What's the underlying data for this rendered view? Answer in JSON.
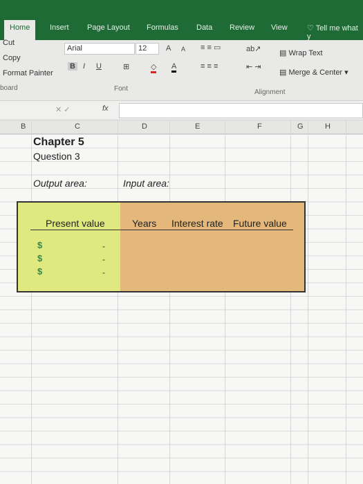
{
  "ribbon": {
    "tabs": [
      {
        "label": "Home"
      },
      {
        "label": "Insert"
      },
      {
        "label": "Page Layout"
      },
      {
        "label": "Formulas"
      },
      {
        "label": "Data"
      },
      {
        "label": "Review"
      },
      {
        "label": "View"
      }
    ],
    "tell_me": "Tell me what y",
    "clipboard": {
      "cut": "Cut",
      "copy": "Copy",
      "format_painter": "Format Painter",
      "group": "board"
    },
    "font": {
      "name": "Arial",
      "size": "12",
      "bold": "B",
      "italic": "I",
      "underline": "U",
      "group": "Font"
    },
    "alignment": {
      "wrap_text": "Wrap Text",
      "merge_center": "Merge & Center",
      "group": "Alignment"
    }
  },
  "formula_bar": {
    "fx": "fx",
    "value": ""
  },
  "columns": [
    "B",
    "C",
    "D",
    "E",
    "F",
    "G",
    "H"
  ],
  "sheet": {
    "title": "Chapter 5",
    "subtitle": "Question 3",
    "output_label": "Output area:",
    "input_label": "Input area:",
    "headers": [
      "Present value",
      "Years",
      "Interest rate",
      "Future value"
    ],
    "rows": [
      {
        "currency": "$",
        "value": "-"
      },
      {
        "currency": "$",
        "value": "-"
      },
      {
        "currency": "$",
        "value": "-"
      }
    ]
  },
  "colors": {
    "ribbon_green": "#1f6b35",
    "output_fill": "#e0e880",
    "input_fill": "#e4b77a"
  }
}
